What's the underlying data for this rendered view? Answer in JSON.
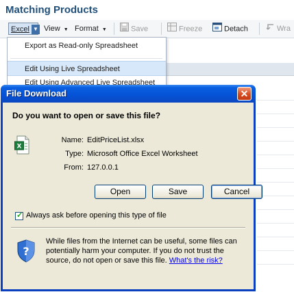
{
  "app": {
    "title": "Matching Products"
  },
  "toolbar": {
    "excel": "Excel",
    "view": "View",
    "format": "Format",
    "save": "Save",
    "freeze": "Freeze",
    "detach": "Detach",
    "wrap": "Wra"
  },
  "menu": {
    "items": [
      {
        "label": "Export as Read-only Spreadsheet"
      },
      {
        "label": "Edit Using Live Spreadsheet"
      },
      {
        "label": "Edit Using Advanced Live Spreadsheet"
      }
    ]
  },
  "dialog": {
    "title": "File Download",
    "question": "Do you want to open or save this file?",
    "name_label": "Name:",
    "name_value": "EditPriceList.xlsx",
    "type_label": "Type:",
    "type_value": "Microsoft Office Excel Worksheet",
    "from_label": "From:",
    "from_value": "127.0.0.1",
    "open_label": "Open",
    "save_label": "Save",
    "cancel_label": "Cancel",
    "checkbox_label": "Always ask before opening this type of file",
    "checkbox_checked": true,
    "warning_text": "While files from the Internet can be useful, some files can potentially harm your computer. If you do not trust the source, do not open or save this file.",
    "risk_link": "What's the risk?"
  },
  "colors": {
    "titlebar": "#0552d6",
    "dialog_bg": "#ece9d8",
    "app_title": "#1f4e79",
    "menu_highlight": "#d6e8f9"
  }
}
